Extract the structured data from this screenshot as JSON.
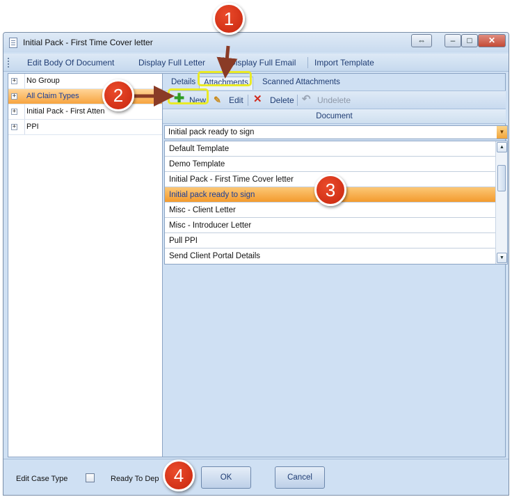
{
  "window": {
    "title": "Initial Pack - First Time Cover letter",
    "controls": {
      "restore": "⇔",
      "minimize": "–",
      "maximize": "□",
      "close": "✕"
    }
  },
  "toolbar": {
    "items": [
      "Edit Body Of Document",
      "Display Full Letter",
      "Display Full Email",
      "Import Template"
    ]
  },
  "tree": {
    "items": [
      {
        "label": "No Group",
        "selected": false
      },
      {
        "label": "All Claim Types",
        "selected": true
      },
      {
        "label": "Initial  Pack - First Atten",
        "selected": false
      },
      {
        "label": "PPI",
        "selected": false
      }
    ],
    "expander": "+"
  },
  "tabs": [
    "Details",
    "Attachments",
    "Scanned Attachments"
  ],
  "active_tab": "Attachments",
  "subtoolbar": {
    "new": "New",
    "edit": "Edit",
    "delete": "Delete",
    "undelete": "Undelete"
  },
  "grid": {
    "column_header": "Document",
    "filter_value": "Initial pack ready to sign",
    "rows": [
      "Default Template",
      "Demo Template",
      "Initial Pack - First Time Cover letter",
      "Initial pack ready to sign",
      "Misc  - Client Letter",
      "Misc  - Introducer Letter",
      "Pull PPI",
      "Send Client Portal Details"
    ],
    "selected_row": "Initial pack ready to sign"
  },
  "bottom": {
    "edit_case_type": "Edit Case Type",
    "ready_to": "Ready To Dep",
    "ok": "OK",
    "cancel": "Cancel"
  },
  "annotations": {
    "markers": [
      "1",
      "2",
      "3",
      "4"
    ],
    "marker_color": "#d9341a",
    "highlight_color": "#e9ea27",
    "arrow_color": "#8a3b26"
  }
}
